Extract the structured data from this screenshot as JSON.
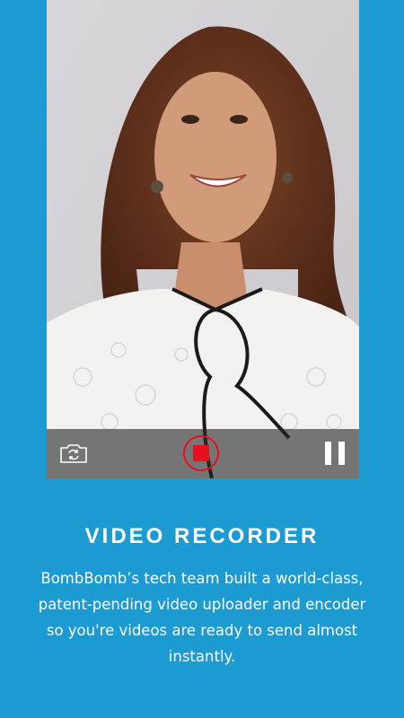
{
  "colors": {
    "background": "#1c9bd3",
    "record_red": "#e8101c",
    "control_bar": "#282828"
  },
  "recorder": {
    "flip_camera_icon": "camera-flip-icon",
    "record_icon": "stop-record-icon",
    "pause_icon": "pause-icon"
  },
  "feature": {
    "title": "VIDEO RECORDER",
    "description": "BombBomb’s tech team built a world-class, patent-pending video uploader and encoder so you're videos are ready to send almost instantly."
  }
}
